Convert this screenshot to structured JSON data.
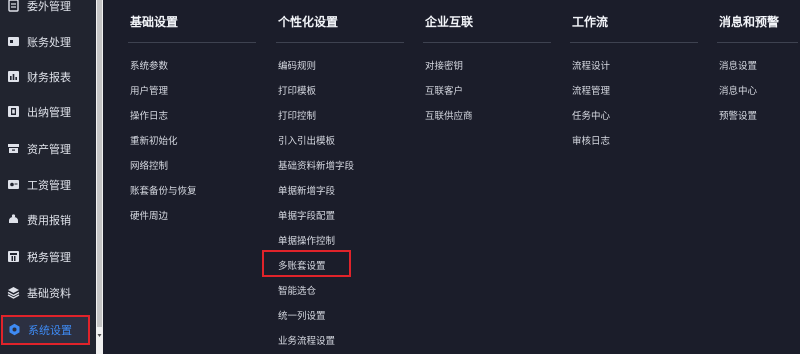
{
  "sidebar": {
    "items": [
      {
        "label": "委外管理",
        "icon": "outsourcing-icon"
      },
      {
        "label": "账务处理",
        "icon": "ledger-icon"
      },
      {
        "label": "财务报表",
        "icon": "report-icon"
      },
      {
        "label": "出纳管理",
        "icon": "cashier-icon"
      },
      {
        "label": "资产管理",
        "icon": "asset-icon"
      },
      {
        "label": "工资管理",
        "icon": "salary-icon"
      },
      {
        "label": "费用报销",
        "icon": "expense-icon"
      },
      {
        "label": "税务管理",
        "icon": "tax-icon"
      },
      {
        "label": "基础资料",
        "icon": "stack-icon"
      },
      {
        "label": "系统设置",
        "icon": "gear-icon",
        "active": true
      }
    ]
  },
  "menu": {
    "columns": [
      {
        "title": "基础设置",
        "items": [
          "系统参数",
          "用户管理",
          "操作日志",
          "重新初始化",
          "网络控制",
          "账套备份与恢复",
          "硬件周边"
        ]
      },
      {
        "title": "个性化设置",
        "items": [
          "编码规则",
          "打印模板",
          "打印控制",
          "引入引出模板",
          "基础资料新增字段",
          "单据新增字段",
          "单据字段配置",
          "单据操作控制",
          "多账套设置",
          "智能选仓",
          "统一列设置",
          "业务流程设置"
        ]
      },
      {
        "title": "企业互联",
        "items": [
          "对接密钥",
          "互联客户",
          "互联供应商"
        ]
      },
      {
        "title": "工作流",
        "items": [
          "流程设计",
          "流程管理",
          "任务中心",
          "审核日志"
        ]
      },
      {
        "title": "消息和预警",
        "items": [
          "消息设置",
          "消息中心",
          "预警设置"
        ]
      }
    ],
    "highlighted_item": "多账套设置"
  },
  "colors": {
    "sidebar_bg": "#21242f",
    "panel_bg": "#1b1d2a",
    "active_text": "#3e8bf5",
    "highlight_border": "#e0232a"
  }
}
